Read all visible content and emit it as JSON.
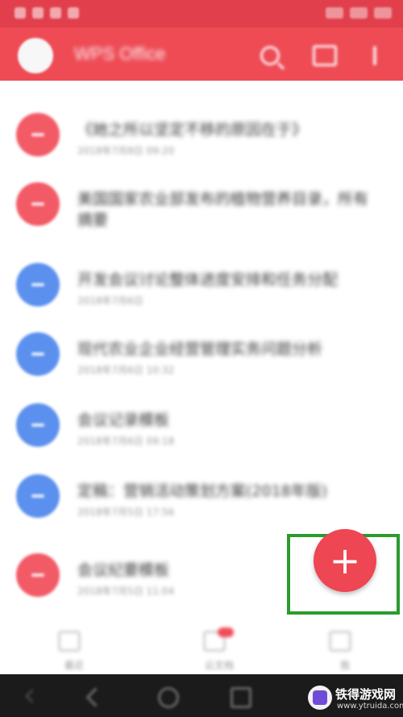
{
  "status_bar": {},
  "app_bar": {
    "title": "WPS Office",
    "icons": [
      "app-logo",
      "search-icon",
      "folder-icon",
      "more-icon"
    ]
  },
  "list": {
    "items": [
      {
        "color": "red",
        "title": "《她之所以坚定不移的原因在于》",
        "subtitle": "2018年7月8日 09:20"
      },
      {
        "color": "red",
        "title": "美国国家农业部发布的植物营养目录，所有",
        "subtitle": "2018年7月7日 18:41",
        "line2": "摘要"
      },
      {
        "color": "blue",
        "title": "开发会议讨论整体进度安排和任务分配",
        "subtitle": "2018年7月6日"
      },
      {
        "color": "blue",
        "title": "现代农业企业经营管理实务问题分析",
        "subtitle": "2018年7月6日 10:32"
      },
      {
        "color": "blue",
        "title": "会议记录模板",
        "subtitle": "2018年7月6日 09:18"
      },
      {
        "color": "blue",
        "title": "定稿：营销活动策划方案(2018年版)",
        "subtitle": "2018年7月5日 17:56"
      },
      {
        "color": "red",
        "title": "会议纪要模板",
        "subtitle": "2018年7月5日 11:04"
      }
    ]
  },
  "fab": {
    "label": "+",
    "color": "#ee4653"
  },
  "highlight": {
    "color": "#2b9b2e"
  },
  "bottom_tabs": [
    {
      "label": "最近",
      "icon": "clock-icon"
    },
    {
      "label": "云文档",
      "icon": "cloud-icon",
      "badge": true
    },
    {
      "label": "我",
      "icon": "user-icon"
    }
  ],
  "watermark": {
    "name": "铁得游戏网",
    "url": "www.ytruida.com"
  }
}
